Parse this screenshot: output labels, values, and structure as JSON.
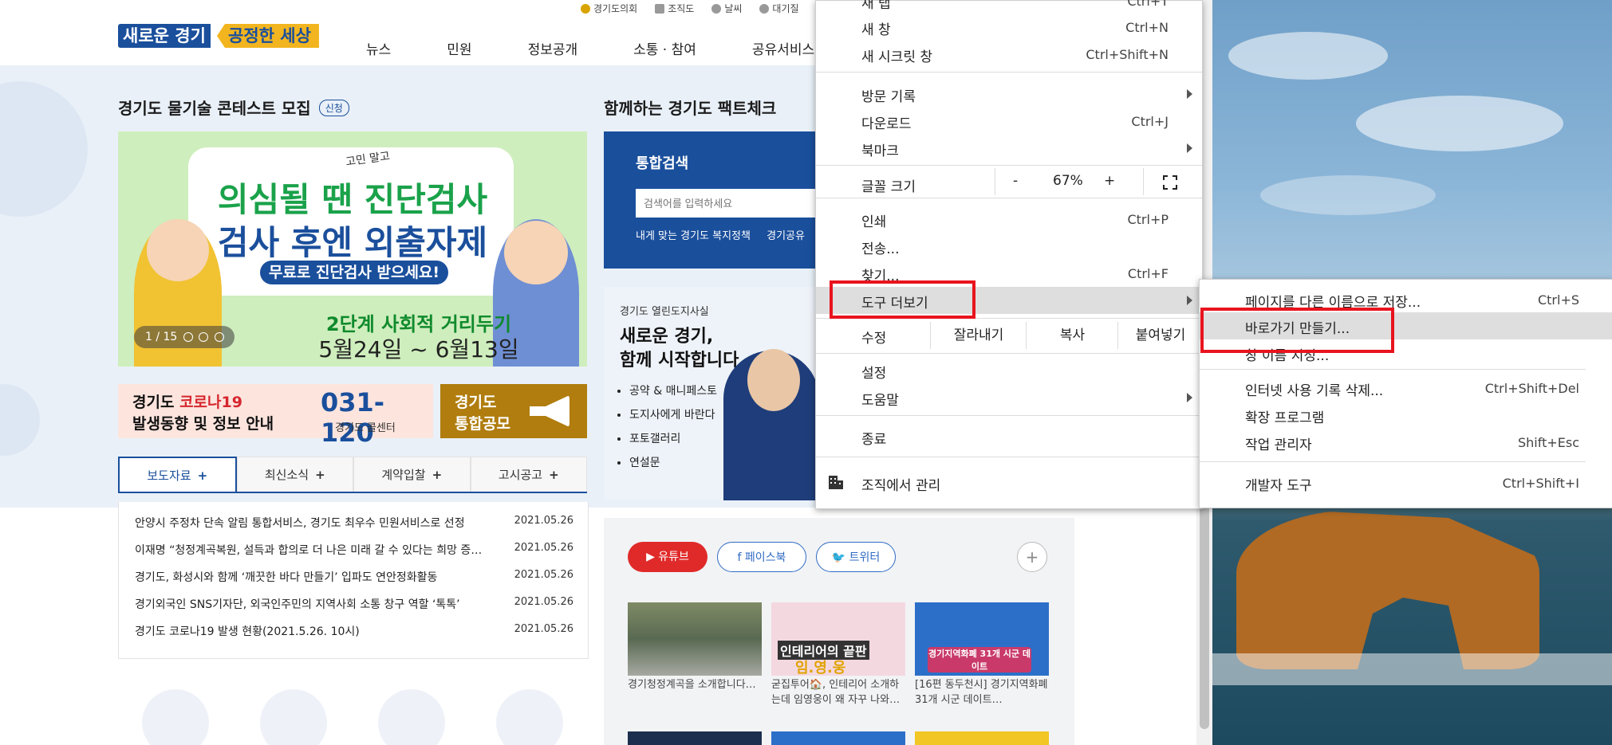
{
  "site": {
    "logo_left": "새로운 경기",
    "logo_right": "공정한 세상",
    "util_links": [
      "경기도의회",
      "조직도",
      "날씨",
      "대기질"
    ],
    "gnb": [
      "뉴스",
      "민원",
      "정보공개",
      "소통 · 참여",
      "공유서비스"
    ],
    "section1_title": "경기도 물기술 콘테스트 모집",
    "section1_badge": "신청",
    "section2_title": "함께하는 경기도 팩트체크",
    "banner": {
      "small_text": "고민 말고",
      "line1": "의심될 땐 진단검사",
      "line2": "검사 후엔 외출자제",
      "pill": "무료로 진단검사 받으세요!",
      "line3": "2단계 사회적 거리두기",
      "line4": "5월24일 ~ 6월13일",
      "pager": "1 / 15"
    },
    "corona_banner": {
      "line1a": "경기도 ",
      "line1b": "코로나19",
      "line2": "발생동향 및 정보 안내",
      "phone": "031-120",
      "phone_sub": "경기도 콜센터",
      "right_line1": "경기도",
      "right_line2": "통합공모"
    },
    "tabs": [
      "보도자료",
      "최신소식",
      "계약입찰",
      "고시공고"
    ],
    "news": [
      {
        "title": "안양시 주정차 단속 알림 통합서비스, 경기도 최우수 민원서비스로 선정",
        "date": "2021.05.26"
      },
      {
        "title": "이재명 “청정계곡복원, 설득과 합의로 더 나은 미래 갈 수 있다는 희망 증…",
        "date": "2021.05.26"
      },
      {
        "title": "경기도, 화성시와 함께 ‘깨끗한 바다 만들기’ 입파도 연안정화활동",
        "date": "2021.05.26"
      },
      {
        "title": "경기외국인 SNS기자단, 외국인주민의 지역사회 소통 창구 역할 ‘톡톡’",
        "date": "2021.05.26"
      },
      {
        "title": "경기도 코로나19 발생 현황(2021.5.26. 10시)",
        "date": "2021.05.26"
      }
    ],
    "search": {
      "title": "통합검색",
      "placeholder": "검색어를 입력하세요",
      "link1": "내게 맞는 경기도 복지정책",
      "link2": "경기공유"
    },
    "gov": {
      "label": "경기도 열린도지사실",
      "title1": "새로운 경기,",
      "title2": "함께 시작합니다",
      "items": [
        "공약 & 매니페스토",
        "도지사에게 바란다",
        "포토갤러리",
        "연설문"
      ]
    },
    "social": {
      "youtube": "유튜브",
      "facebook": "페이스북",
      "twitter": "트위터",
      "plus": "+",
      "captions": [
        "경기청정계곡을 소개합니다…",
        "굳집투어🏠, 인테리어 소개하는데 임영웅이 왜 자꾸 나와…",
        "[16편 동두천시] 경기지역화폐 31개 시군 데이트…"
      ],
      "thumb2_text": "인테리어의 끝판",
      "thumb2_sub": "임.영.웅",
      "thumb3_text": "경기지역화폐 31개 시군 데이트"
    }
  },
  "menu": {
    "items": [
      {
        "label": "새 탭",
        "shortcut": "Ctrl+T"
      },
      {
        "label": "새 창",
        "shortcut": "Ctrl+N"
      },
      {
        "label": "새 시크릿 창",
        "shortcut": "Ctrl+Shift+N"
      },
      {
        "label": "방문 기록",
        "shortcut": ""
      },
      {
        "label": "다운로드",
        "shortcut": "Ctrl+J"
      },
      {
        "label": "북마크",
        "shortcut": ""
      }
    ],
    "zoom_label": "글꼴 크기",
    "zoom_minus": "-",
    "zoom_value": "67%",
    "zoom_plus": "+",
    "items2": [
      {
        "label": "인쇄",
        "shortcut": "Ctrl+P"
      },
      {
        "label": "전송...",
        "shortcut": ""
      },
      {
        "label": "찾기...",
        "shortcut": "Ctrl+F"
      },
      {
        "label": "도구 더보기",
        "shortcut": ""
      }
    ],
    "edit_label": "수정",
    "edit_cut": "잘라내기",
    "edit_copy": "복사",
    "edit_paste": "붙여넣기",
    "settings": "설정",
    "help": "도움말",
    "exit": "종료",
    "managed": "조직에서 관리"
  },
  "submenu": {
    "items": [
      {
        "label": "페이지를 다른 이름으로 저장...",
        "shortcut": "Ctrl+S"
      },
      {
        "label": "바로가기 만들기...",
        "shortcut": ""
      },
      {
        "label": "창 이름 지정...",
        "shortcut": ""
      },
      {
        "label": "인터넷 사용 기록 삭제...",
        "shortcut": "Ctrl+Shift+Del"
      },
      {
        "label": "확장 프로그램",
        "shortcut": ""
      },
      {
        "label": "작업 관리자",
        "shortcut": "Shift+Esc"
      },
      {
        "label": "개발자 도구",
        "shortcut": "Ctrl+Shift+I"
      }
    ]
  },
  "colors": {
    "brand_blue": "#1a4f9c",
    "brand_yellow": "#f2b51f",
    "highlight_red": "#e8141e",
    "menu_highlight": "#dedede"
  }
}
